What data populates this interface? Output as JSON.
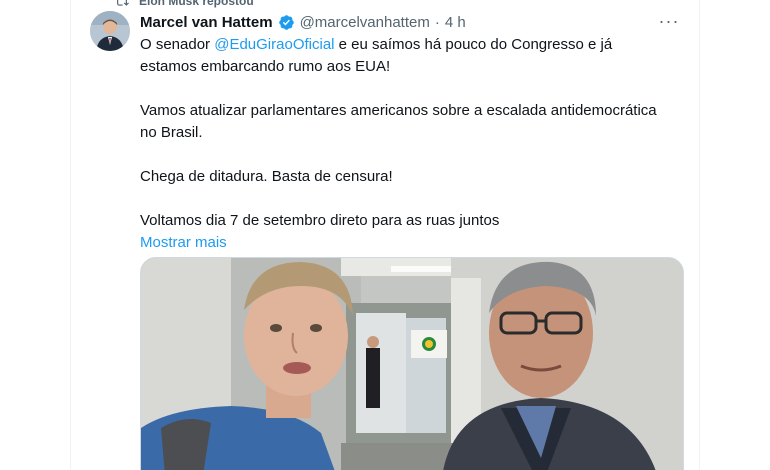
{
  "repost": {
    "icon": "repost-icon",
    "text": "Elon Musk repostou"
  },
  "tweet": {
    "author_name": "Marcel van Hattem",
    "verified_icon": "verified-badge-icon",
    "handle": "@marcelvanhattem",
    "separator": "·",
    "time": "4 h",
    "more_icon": "more-options-icon",
    "more_label": "···",
    "text": {
      "line1_before": "O senador ",
      "mention": "@EduGiraoOficial",
      "line1_after": " e eu saímos há pouco do Congresso e já estamos embarcando rumo aos EUA!",
      "para2": "Vamos atualizar parlamentares americanos sobre a escalada antidemocrática no Brasil.",
      "para3": "Chega de ditadura. Basta de censura!",
      "para4": "Voltamos dia 7 de setembro direto para as ruas juntos",
      "show_more": "Mostrar mais"
    }
  },
  "colors": {
    "link": "#1d9bf0",
    "secondary": "#536471",
    "primary": "#0f1419"
  }
}
